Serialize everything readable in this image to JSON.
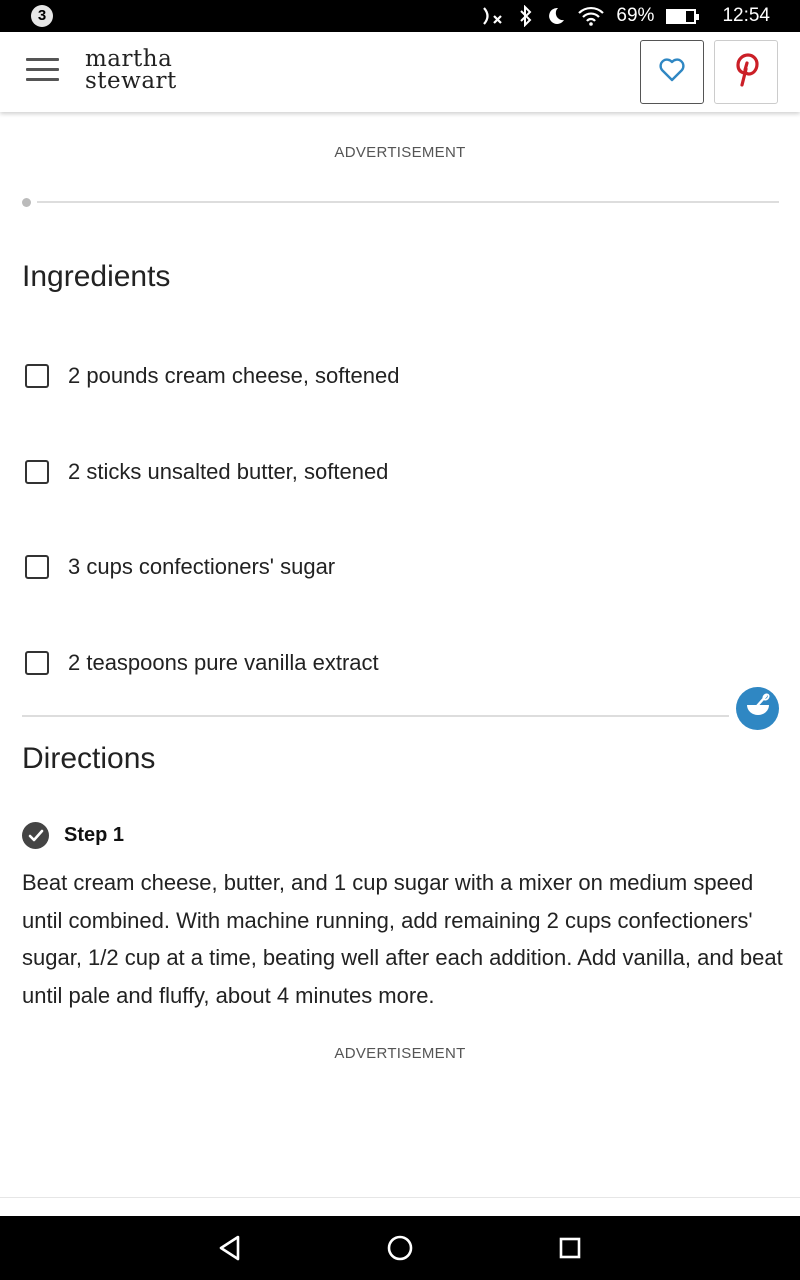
{
  "status_bar": {
    "notification_count": "3",
    "icons": [
      "nfc-off-icon",
      "bluetooth-icon",
      "do-not-disturb-moon-icon",
      "wifi-icon"
    ],
    "battery_percent": "69%",
    "battery_level": 0.69,
    "time": "12:54"
  },
  "header": {
    "logo_line1": "martha",
    "logo_line2": "stewart",
    "favorite_icon": "heart-outline-icon",
    "pinterest_icon": "pinterest-icon",
    "accent_color": "#2f87c3",
    "pinterest_color": "#cb1f27"
  },
  "ad_label_top": "ADVERTISEMENT",
  "ingredients": {
    "title": "Ingredients",
    "items": [
      {
        "text": "2 pounds cream cheese, softened",
        "checked": false
      },
      {
        "text": "2 sticks unsalted butter, softened",
        "checked": false
      },
      {
        "text": "3 cups confectioners' sugar",
        "checked": false
      },
      {
        "text": "2 teaspoons pure vanilla extract",
        "checked": false
      }
    ]
  },
  "directions": {
    "title": "Directions",
    "steps": [
      {
        "label": "Step 1",
        "completed": true,
        "text": "Beat cream cheese, butter, and 1 cup sugar with a mixer on medium speed until combined. With machine running, add remaining 2 cups confectioners' sugar, 1/2 cup at a time, beating well after each addition. Add vanilla, and beat until pale and fluffy, about 4 minutes more."
      }
    ]
  },
  "ad_label_bottom": "ADVERTISEMENT",
  "nav_bar": {
    "icons": [
      "back-triangle-icon",
      "home-circle-icon",
      "recents-square-icon"
    ]
  }
}
